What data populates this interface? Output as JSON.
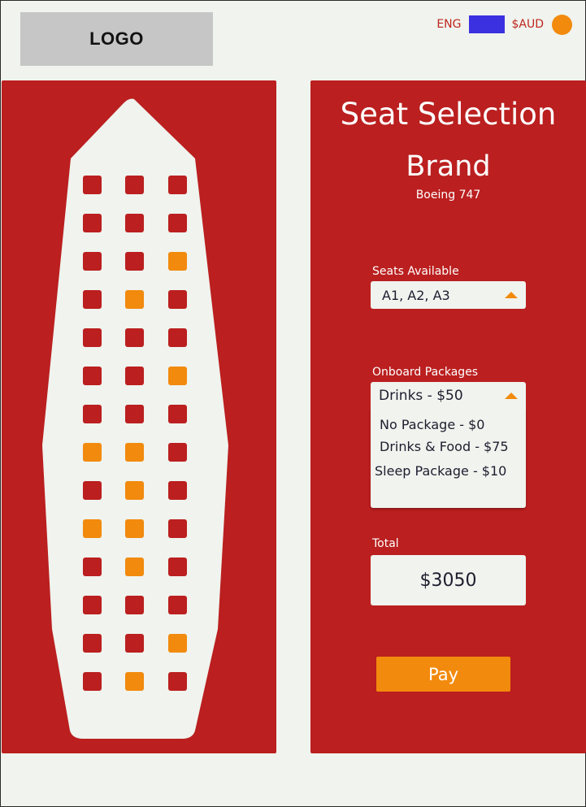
{
  "header": {
    "logo": "LOGO",
    "language": "ENG",
    "currency": "$AUD",
    "swatch_color": "#3b31e0",
    "status_dot_color": "#f28a0d"
  },
  "colors": {
    "panel": "#bb1f1f",
    "seat_taken": "#bb1f1f",
    "seat_available": "#f28a0d",
    "background": "#f0f3ee"
  },
  "seat_map": {
    "rows": [
      [
        "taken",
        "taken",
        "taken"
      ],
      [
        "taken",
        "taken",
        "taken"
      ],
      [
        "taken",
        "taken",
        "available"
      ],
      [
        "taken",
        "available",
        "taken"
      ],
      [
        "taken",
        "taken",
        "taken"
      ],
      [
        "taken",
        "taken",
        "available"
      ],
      [
        "taken",
        "taken",
        "taken"
      ],
      [
        "available",
        "available",
        "taken"
      ],
      [
        "taken",
        "available",
        "taken"
      ],
      [
        "available",
        "available",
        "taken"
      ],
      [
        "taken",
        "available",
        "taken"
      ],
      [
        "taken",
        "taken",
        "taken"
      ],
      [
        "taken",
        "taken",
        "available"
      ],
      [
        "taken",
        "available",
        "taken"
      ]
    ]
  },
  "panel": {
    "title": "Seat Selection",
    "brand": "Brand",
    "aircraft": "Boeing 747",
    "seats_label": "Seats Available",
    "seats_value": "A1, A2, A3",
    "packages_label": "Onboard Packages",
    "packages_value": "Drinks - $50",
    "package_options": [
      "No Package - $0",
      "Drinks & Food - $75",
      "Sleep Package - $10"
    ],
    "total_label": "Total",
    "total_value": "$3050",
    "pay_label": "Pay"
  }
}
